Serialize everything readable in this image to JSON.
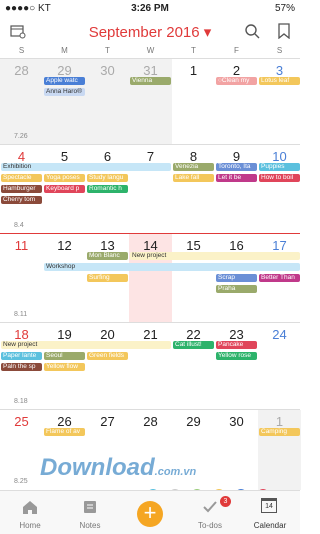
{
  "status": {
    "carrier": "●●●●○ KT",
    "time": "3:26 PM",
    "battery": "57%"
  },
  "header": {
    "title": "September 2016 ▾"
  },
  "weekdays": [
    "S",
    "M",
    "T",
    "W",
    "T",
    "F",
    "S"
  ],
  "weeks": [
    {
      "num": "7.26",
      "days": [
        "28",
        "29",
        "30",
        "31",
        "1",
        "2",
        "3"
      ]
    },
    {
      "num": "8.4",
      "days": [
        "4",
        "5",
        "6",
        "7",
        "8",
        "9",
        "10"
      ]
    },
    {
      "num": "8.11",
      "days": [
        "11",
        "12",
        "13",
        "14",
        "15",
        "16",
        "17"
      ]
    },
    {
      "num": "8.18",
      "days": [
        "18",
        "19",
        "20",
        "21",
        "22",
        "23",
        "24"
      ]
    },
    {
      "num": "8.25",
      "days": [
        "25",
        "26",
        "27",
        "28",
        "29",
        "30",
        "1"
      ]
    }
  ],
  "events": [
    {
      "w": 0,
      "d": 1,
      "span": 1,
      "row": 0,
      "label": "Apple watc",
      "color": "#4a7fd6",
      "text": "#fff"
    },
    {
      "w": 0,
      "d": 1,
      "span": 1,
      "row": 1,
      "label": "Anna Haro®",
      "color": "#c9d9f2",
      "text": "#333"
    },
    {
      "w": 0,
      "d": 3,
      "span": 1,
      "row": 0,
      "label": "Vienna",
      "color": "#9aaa6b",
      "text": "#fff"
    },
    {
      "w": 0,
      "d": 5,
      "span": 1,
      "row": 0,
      "label": "○Clean my",
      "color": "#f2a3a3",
      "text": "#fff"
    },
    {
      "w": 0,
      "d": 6,
      "span": 1,
      "row": 0,
      "label": "Lotus leaf",
      "color": "#f3c75b",
      "text": "#fff"
    },
    {
      "w": 1,
      "d": 0,
      "span": 4,
      "row": 0,
      "label": "Exhibition",
      "color": "#c6e6f7",
      "text": "#333"
    },
    {
      "w": 1,
      "d": 0,
      "span": 1,
      "row": 1,
      "label": "Spectacle",
      "color": "#f3c75b",
      "text": "#fff"
    },
    {
      "w": 1,
      "d": 1,
      "span": 1,
      "row": 1,
      "label": "Yoga poses",
      "color": "#f3c75b",
      "text": "#fff"
    },
    {
      "w": 1,
      "d": 2,
      "span": 1,
      "row": 1,
      "label": "Study langu",
      "color": "#f3c75b",
      "text": "#fff"
    },
    {
      "w": 1,
      "d": 0,
      "span": 1,
      "row": 2,
      "label": "Hamburger",
      "color": "#8b4a3a",
      "text": "#fff"
    },
    {
      "w": 1,
      "d": 1,
      "span": 1,
      "row": 2,
      "label": "Keyboard p",
      "color": "#e0455a",
      "text": "#fff"
    },
    {
      "w": 1,
      "d": 2,
      "span": 1,
      "row": 2,
      "label": "Romantic h",
      "color": "#2db36b",
      "text": "#fff"
    },
    {
      "w": 1,
      "d": 0,
      "span": 1,
      "row": 3,
      "label": "Cherry tom",
      "color": "#8b4a3a",
      "text": "#fff"
    },
    {
      "w": 1,
      "d": 4,
      "span": 1,
      "row": 0,
      "label": "Venezia",
      "color": "#9aaa6b",
      "text": "#fff"
    },
    {
      "w": 1,
      "d": 5,
      "span": 1,
      "row": 0,
      "label": "Toronto, Ita",
      "color": "#6a8fd6",
      "text": "#fff"
    },
    {
      "w": 1,
      "d": 6,
      "span": 1,
      "row": 0,
      "label": "Puppies",
      "color": "#5bc0de",
      "text": "#fff"
    },
    {
      "w": 1,
      "d": 4,
      "span": 1,
      "row": 1,
      "label": "Lake fall",
      "color": "#f3c75b",
      "text": "#fff"
    },
    {
      "w": 1,
      "d": 5,
      "span": 1,
      "row": 1,
      "label": "Let it be",
      "color": "#c0398a",
      "text": "#fff"
    },
    {
      "w": 1,
      "d": 6,
      "span": 1,
      "row": 1,
      "label": "How to boil",
      "color": "#e0455a",
      "text": "#fff"
    },
    {
      "w": 2,
      "d": 2,
      "span": 1,
      "row": 0,
      "label": "Mon Blanc",
      "color": "#9aaa6b",
      "text": "#fff"
    },
    {
      "w": 2,
      "d": 3,
      "span": 4,
      "row": 0,
      "label": "New project",
      "color": "#fbf2c8",
      "text": "#333"
    },
    {
      "w": 2,
      "d": 1,
      "span": 6,
      "row": 1,
      "label": "Workshop",
      "color": "#c6e6f7",
      "text": "#333"
    },
    {
      "w": 2,
      "d": 2,
      "span": 1,
      "row": 2,
      "label": "Surfing",
      "color": "#f3c75b",
      "text": "#fff"
    },
    {
      "w": 2,
      "d": 5,
      "span": 1,
      "row": 2,
      "label": "Scrap",
      "color": "#6a8fd6",
      "text": "#fff"
    },
    {
      "w": 2,
      "d": 6,
      "span": 1,
      "row": 2,
      "label": "Better Than",
      "color": "#c0398a",
      "text": "#fff"
    },
    {
      "w": 2,
      "d": 5,
      "span": 1,
      "row": 3,
      "label": "Praha",
      "color": "#9aaa6b",
      "text": "#fff"
    },
    {
      "w": 3,
      "d": 0,
      "span": 4,
      "row": 0,
      "label": "New project",
      "color": "#fbf2c8",
      "text": "#333"
    },
    {
      "w": 3,
      "d": 4,
      "span": 1,
      "row": 0,
      "label": "Cat illust!",
      "color": "#2db36b",
      "text": "#fff"
    },
    {
      "w": 3,
      "d": 5,
      "span": 1,
      "row": 0,
      "label": "Pancake",
      "color": "#e0455a",
      "text": "#fff"
    },
    {
      "w": 3,
      "d": 0,
      "span": 1,
      "row": 1,
      "label": "Paper lante",
      "color": "#5bc0de",
      "text": "#fff"
    },
    {
      "w": 3,
      "d": 1,
      "span": 1,
      "row": 1,
      "label": "Seoul",
      "color": "#9aaa6b",
      "text": "#fff"
    },
    {
      "w": 3,
      "d": 2,
      "span": 1,
      "row": 1,
      "label": "Green fields",
      "color": "#f3c75b",
      "text": "#fff"
    },
    {
      "w": 3,
      "d": 5,
      "span": 1,
      "row": 1,
      "label": "Yellow rose",
      "color": "#2db36b",
      "text": "#fff"
    },
    {
      "w": 3,
      "d": 0,
      "span": 1,
      "row": 2,
      "label": "Paln the sp",
      "color": "#8b4a3a",
      "text": "#fff"
    },
    {
      "w": 3,
      "d": 1,
      "span": 1,
      "row": 2,
      "label": "Yellow flow",
      "color": "#f3c75b",
      "text": "#fff"
    },
    {
      "w": 4,
      "d": 1,
      "span": 1,
      "row": 0,
      "label": "Flame of av",
      "color": "#f3c75b",
      "text": "#fff"
    },
    {
      "w": 4,
      "d": 6,
      "span": 1,
      "row": 0,
      "label": "Camping",
      "color": "#f3c75b",
      "text": "#fff"
    }
  ],
  "tabs": {
    "home": "Home",
    "notes": "Notes",
    "todos": "To-dos",
    "todos_badge": "3",
    "calendar": "Calendar",
    "calendar_day": "14"
  },
  "watermark": {
    "main": "Download",
    "suffix": ".com.vn"
  },
  "colors": {
    "accent": "#e03a3a",
    "fab": "#f5a623",
    "today_bg": "#fde4e4"
  }
}
